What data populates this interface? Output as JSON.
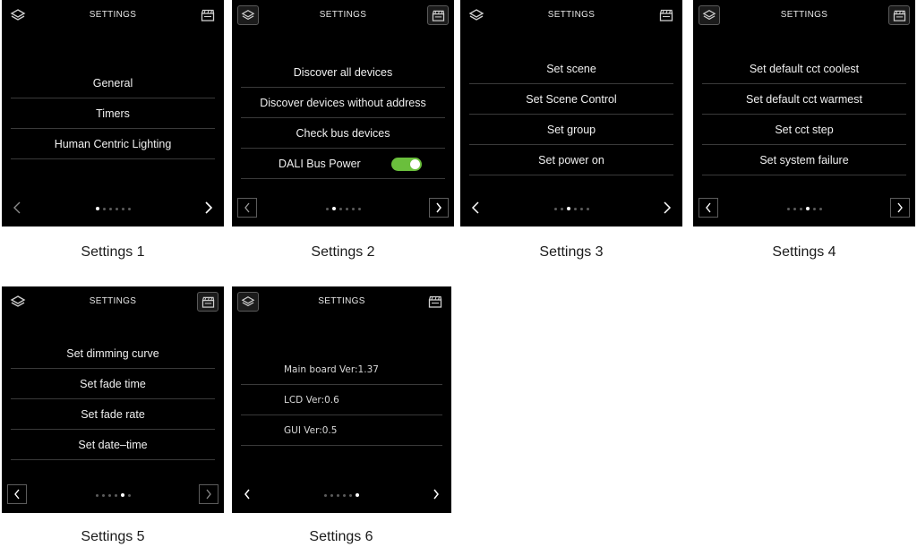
{
  "screens": [
    {
      "title": "SETTINGS",
      "caption": "Settings 1",
      "items": [
        "General",
        "Timers",
        "Human Centric Lighting"
      ],
      "page_index": 1,
      "page_count": 6
    },
    {
      "title": "SETTINGS",
      "caption": "Settings 2",
      "items": [
        "Discover all devices",
        "Discover devices without address",
        "Check bus devices",
        "DALI Bus Power"
      ],
      "toggle_on": true,
      "page_index": 2,
      "page_count": 6
    },
    {
      "title": "SETTINGS",
      "caption": "Settings 3",
      "items": [
        "Set scene",
        "Set Scene Control",
        "Set group",
        "Set power on"
      ],
      "page_index": 3,
      "page_count": 6
    },
    {
      "title": "SETTINGS",
      "caption": "Settings 4",
      "items": [
        "Set default cct coolest",
        "Set default cct warmest",
        "Set cct step",
        "Set system failure"
      ],
      "page_index": 4,
      "page_count": 6
    },
    {
      "title": "SETTINGS",
      "caption": "Settings 5",
      "items": [
        "Set dimming curve",
        "Set fade time",
        "Set fade rate",
        "Set date–time"
      ],
      "page_index": 5,
      "page_count": 6
    },
    {
      "title": "SETTINGS",
      "caption": "Settings 6",
      "items": [
        "Main board Ver:1.37",
        "LCD Ver:0.6",
        "GUI Ver:0.5"
      ],
      "page_index": 6,
      "page_count": 6
    }
  ],
  "icons": {
    "top_left": "layers-icon",
    "top_right": "scene-clapper-icon",
    "prev": "chevron-left-icon",
    "next": "chevron-right-icon"
  },
  "colors": {
    "screen_bg": "#000000",
    "toggle_on": "#6abf3c",
    "divider": "#3a3a3a"
  }
}
